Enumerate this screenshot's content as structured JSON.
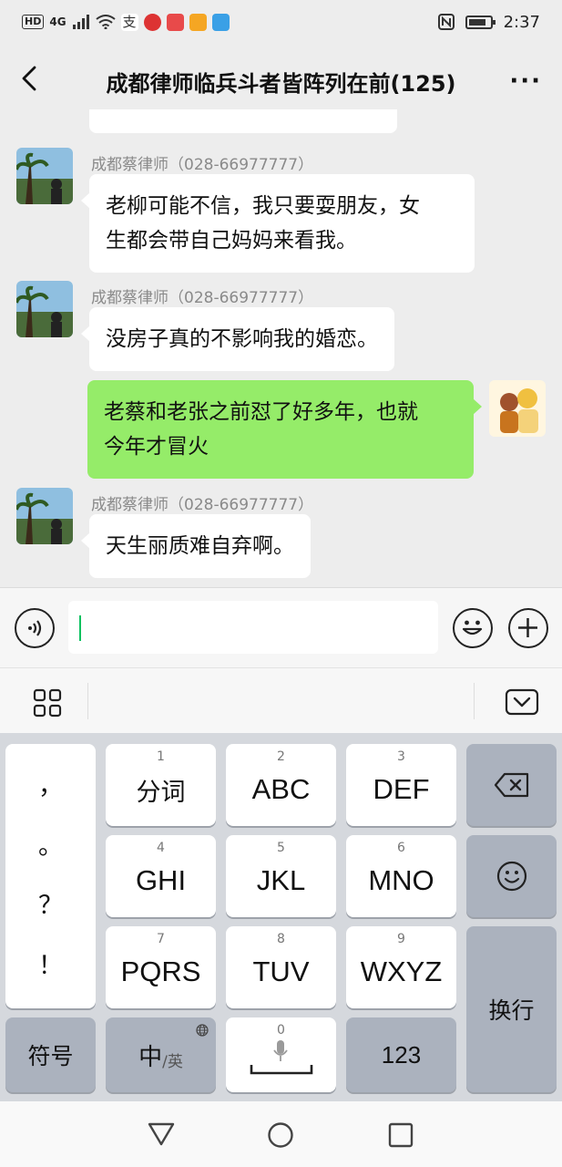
{
  "status_bar": {
    "network_label": "HD",
    "signal_label": "4G",
    "time": "2:37"
  },
  "header": {
    "title": "成都律师临兵斗者皆阵列在前(125)",
    "more_label": "···"
  },
  "messages": [
    {
      "side": "in",
      "sender": "成都蔡律师（028-66977777）",
      "text_lines": [
        "老柳可能不信，我只要耍朋友，女",
        "生都会带自己妈妈来看我。"
      ]
    },
    {
      "side": "in",
      "sender": "成都蔡律师（028-66977777）",
      "text_lines": [
        "没房子真的不影响我的婚恋。"
      ]
    },
    {
      "side": "out",
      "text_lines": [
        "老蔡和老张之前怼了好多年，也就",
        "今年才冒火"
      ]
    },
    {
      "side": "in",
      "sender": "成都蔡律师（028-66977777）",
      "text_lines": [
        "天生丽质难自弃啊。"
      ]
    }
  ],
  "keyboard": {
    "punct": [
      "，",
      "。",
      "？",
      "！"
    ],
    "row1": [
      {
        "num": "1",
        "label": "分词"
      },
      {
        "num": "2",
        "label": "ABC"
      },
      {
        "num": "3",
        "label": "DEF"
      }
    ],
    "row2": [
      {
        "num": "4",
        "label": "GHI"
      },
      {
        "num": "5",
        "label": "JKL"
      },
      {
        "num": "6",
        "label": "MNO"
      }
    ],
    "row3": [
      {
        "num": "7",
        "label": "PQRS"
      },
      {
        "num": "8",
        "label": "TUV"
      },
      {
        "num": "9",
        "label": "WXYZ"
      }
    ],
    "symbol_label": "符号",
    "lang_main": "中",
    "lang_sub": "/英",
    "space_num": "0",
    "num_label": "123",
    "enter_label": "换行"
  },
  "icons": {
    "back": "chevron-left-icon",
    "voice": "voice-icon",
    "emoji": "emoji-icon",
    "plus": "plus-icon",
    "grid": "grid-icon",
    "hide_keyboard": "keyboard-hide-icon",
    "backspace": "backspace-icon",
    "smiley": "smiley-icon",
    "mic": "mic-icon",
    "globe": "globe-icon"
  },
  "colors": {
    "outgoing_bubble": "#95ec69",
    "incoming_bubble": "#ffffff",
    "caret": "#07c160"
  }
}
